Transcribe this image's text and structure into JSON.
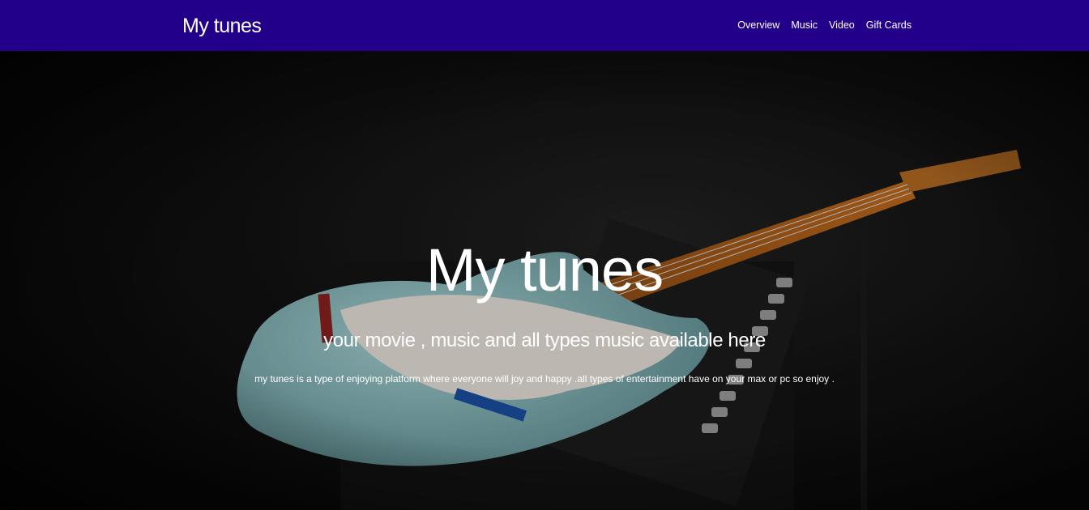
{
  "navbar": {
    "brand": "My tunes",
    "background": "#22008a",
    "links": [
      {
        "label": "Overview"
      },
      {
        "label": "Music"
      },
      {
        "label": "Video"
      },
      {
        "label": "Gift Cards"
      }
    ]
  },
  "hero": {
    "title": "My tunes",
    "subtitle": "your movie , music and all types music available here",
    "description": "my tunes is a type of enjoying platform where everyone will joy and happy .all types of entertainment have on your max or pc so enjoy .",
    "background_image": "electric-guitar-on-amplifier"
  }
}
